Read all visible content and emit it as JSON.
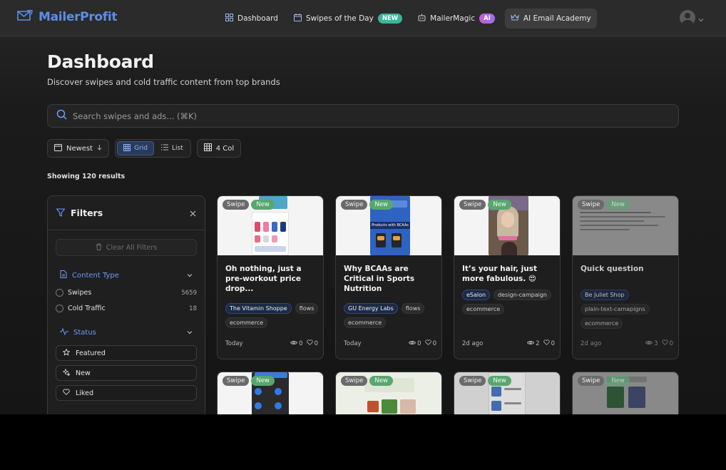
{
  "app": {
    "name": "MailerProfit"
  },
  "nav": [
    {
      "label": "Dashboard",
      "icon": "grid-icon"
    },
    {
      "label": "Swipes of the Day",
      "icon": "calendar-icon",
      "badge": "NEW"
    },
    {
      "label": "MailerMagic",
      "icon": "robot-icon",
      "badge": "AI"
    },
    {
      "label": "AI Email Academy",
      "icon": "crown-icon",
      "active": true
    }
  ],
  "page": {
    "title": "Dashboard",
    "subtitle": "Discover swipes and cold traffic content from top brands"
  },
  "search": {
    "placeholder": "Search swipes and ads... (⌘K)"
  },
  "controls": {
    "sort_label": "Newest",
    "view_grid": "Grid",
    "view_list": "List",
    "columns_label": "4 Col",
    "active_view": "grid"
  },
  "results": {
    "text": "Showing 120 results"
  },
  "filters": {
    "title": "Filters",
    "clear_label": "Clear All Filters",
    "content_type": {
      "label": "Content Type",
      "options": [
        {
          "label": "Swipes",
          "count": "5659"
        },
        {
          "label": "Cold Traffic",
          "count": "18"
        }
      ]
    },
    "status": {
      "label": "Status",
      "options": [
        {
          "label": "Featured"
        },
        {
          "label": "New"
        },
        {
          "label": "Liked"
        }
      ]
    }
  },
  "card_badges": {
    "swipe": "Swipe",
    "new": "New"
  },
  "cards": [
    {
      "title": "Oh nothing, just a pre-workout price drop...",
      "brand": "The Vitamin Shoppe",
      "tags": [
        "flows",
        "ecommerce"
      ],
      "date": "Today",
      "views": "0",
      "likes": "0"
    },
    {
      "title": "Why BCAAs are Critical in Sports Nutrition",
      "brand": "GU Energy Labs",
      "tags": [
        "flows",
        "ecommerce"
      ],
      "date": "Today",
      "views": "0",
      "likes": "0",
      "thumb_text": "Products with BCAAs"
    },
    {
      "title": "It’s your hair, just more fabulous. 😍",
      "brand": "eSalon",
      "tags": [
        "design-campaign",
        "ecommerce"
      ],
      "date": "2d ago",
      "views": "2",
      "likes": "0"
    },
    {
      "title": "Quick question",
      "brand": "Be Juliet Shop",
      "tags": [
        "plain-text-camapigns",
        "ecommerce"
      ],
      "date": "2d ago",
      "views": "3",
      "likes": "0"
    }
  ],
  "colors": {
    "accent": "#5b8fe6",
    "new_badge": "#5aa670",
    "nav_new": "#3fb39a",
    "link_blue": "#6b9cff"
  }
}
